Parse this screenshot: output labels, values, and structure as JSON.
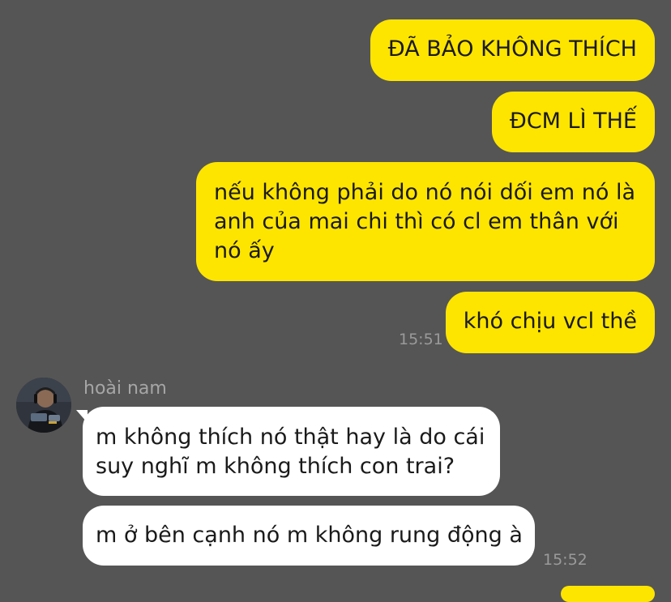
{
  "colors": {
    "background": "#555555",
    "outgoing_bubble": "#fee500",
    "incoming_bubble": "#ffffff",
    "text": "#1a1a1a",
    "timestamp": "#9a9a9a"
  },
  "outgoing": [
    {
      "text": "ĐÃ BẢO KHÔNG THÍCH"
    },
    {
      "text": "ĐCM LÌ THẾ"
    },
    {
      "lines": [
        "nếu không phải do nó nói dối em nó là",
        "anh của mai chi thì có cl em thân với",
        "nó ấy"
      ]
    },
    {
      "text": "khó chịu vcl thề"
    }
  ],
  "outgoing_time": "15:51",
  "incoming": {
    "sender_name": "hoài nam",
    "avatar_icon": "user-avatar-photo",
    "messages": [
      {
        "lines": [
          "m không thích nó thật hay là do cái",
          "suy nghĩ m không thích con trai?"
        ]
      },
      {
        "text": "m ở bên cạnh nó m không rung động à"
      }
    ],
    "time": "15:52"
  }
}
